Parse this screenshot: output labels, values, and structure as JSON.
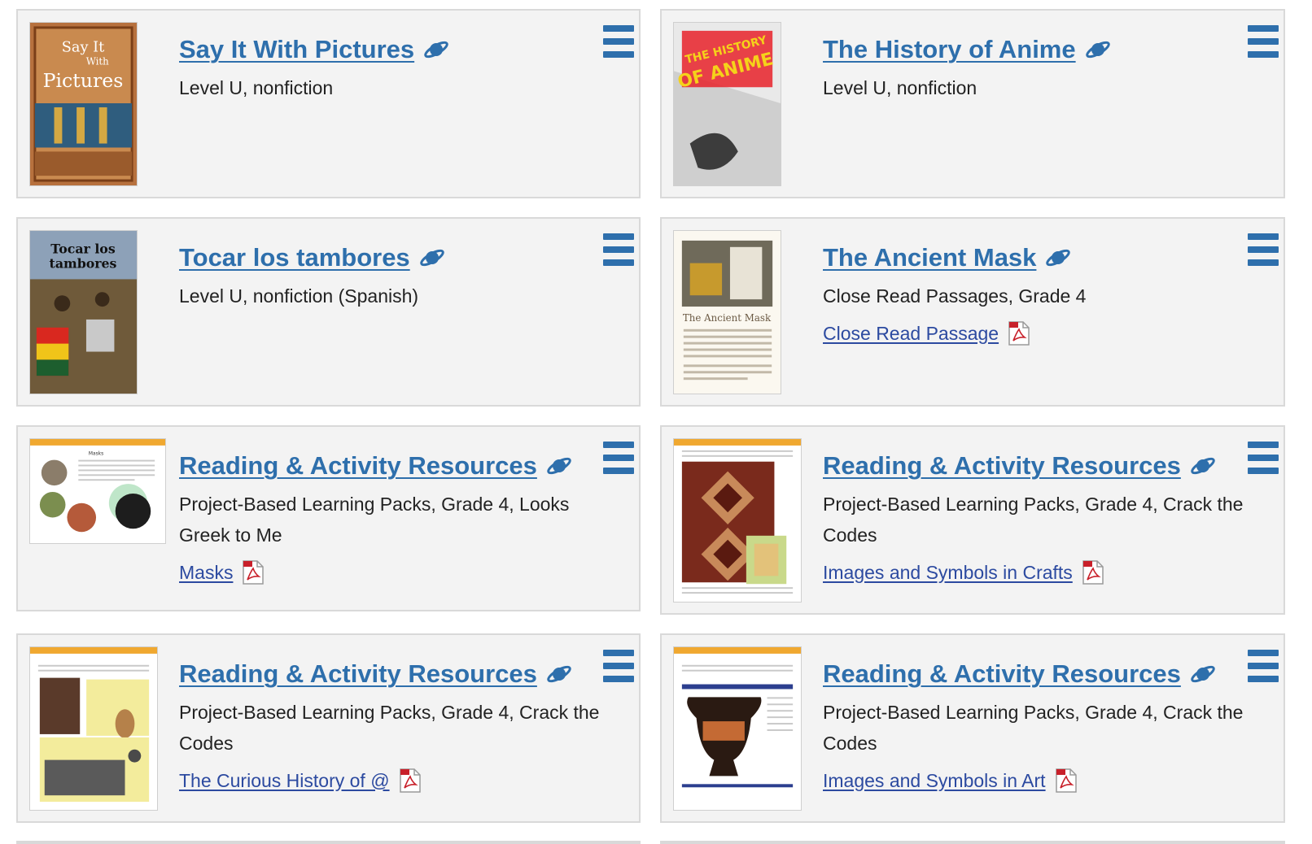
{
  "cards": [
    {
      "title": "Say It With Pictures",
      "subtitle": "Level U, nonfiction",
      "resource": "",
      "thumb_text": [
        "Say It",
        "With",
        "Pictures"
      ]
    },
    {
      "title": "The History of Anime",
      "subtitle": "Level U, nonfiction",
      "resource": "",
      "thumb_text": [
        "THE HISTORY",
        "OF ANIME"
      ]
    },
    {
      "title": "Tocar los tambores",
      "subtitle": "Level U, nonfiction (Spanish)",
      "resource": "",
      "thumb_text": [
        "Tocar los",
        "tambores"
      ]
    },
    {
      "title": "The Ancient Mask",
      "subtitle": "Close Read Passages, Grade 4",
      "resource": "Close Read Passage",
      "thumb_text": [
        "The Ancient Mask"
      ]
    },
    {
      "title": "Reading & Activity Resources",
      "subtitle": "Project-Based Learning Packs, Grade 4, Looks Greek to Me",
      "resource": "Masks",
      "thumb_text": [
        "Masks"
      ]
    },
    {
      "title": "Reading & Activity Resources",
      "subtitle": "Project-Based Learning Packs, Grade 4, Crack the Codes",
      "resource": "Images and Symbols in Crafts",
      "thumb_text": []
    },
    {
      "title": "Reading & Activity Resources",
      "subtitle": "Project-Based Learning Packs, Grade 4, Crack the Codes",
      "resource": "The Curious History of @",
      "thumb_text": []
    },
    {
      "title": "Reading & Activity Resources",
      "subtitle": "Project-Based Learning Packs, Grade 4, Crack the Codes",
      "resource": "Images and Symbols in Art",
      "thumb_text": []
    }
  ],
  "icons": {
    "title_icon": "planet-icon",
    "menu_icon": "hamburger-menu-icon",
    "file_icon": "pdf-icon"
  },
  "colors": {
    "title": "#2e6fac",
    "link": "#2c4aa0",
    "card_bg": "#f3f3f3",
    "card_border": "#d9d9d9",
    "pdf_red": "#c8202a"
  }
}
